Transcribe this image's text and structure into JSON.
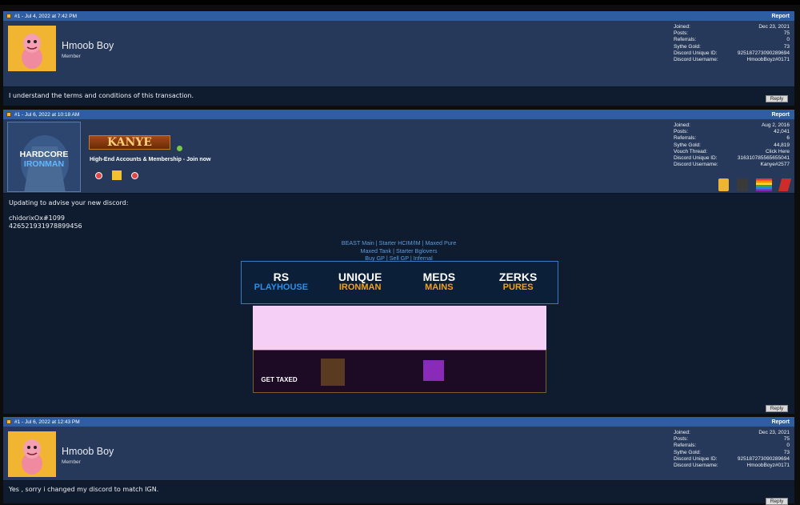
{
  "posts": [
    {
      "header": "#1 - Jul 4, 2022 at 7:42 PM",
      "report": "Report",
      "username": "Hmoob Boy",
      "role": "Member",
      "stats": [
        {
          "k": "Joined:",
          "v": "Dec 23, 2021"
        },
        {
          "k": "Posts:",
          "v": "75"
        },
        {
          "k": "Referrals:",
          "v": "0"
        },
        {
          "k": "Sythe Gold:",
          "v": "73"
        },
        {
          "k": "Discord Unique ID:",
          "v": "925187273090289694"
        },
        {
          "k": "Discord Username:",
          "v": "HmoobBoyz#0171"
        }
      ],
      "message": "I understand the terms and conditions of this transaction.",
      "reply": "Reply"
    },
    {
      "header": "#1 - Jul 6, 2022 at 10:18 AM",
      "report": "Report",
      "username": "KANYE",
      "avatar_line1": "HARDCORE",
      "avatar_line2": "IRONMAN",
      "tagline": "High-End Accounts & Membership - Join now",
      "stats": [
        {
          "k": "Joined:",
          "v": "Aug 2, 2016"
        },
        {
          "k": "Posts:",
          "v": "42,041"
        },
        {
          "k": "Referrals:",
          "v": "6"
        },
        {
          "k": "Sythe Gold:",
          "v": "44,819"
        },
        {
          "k": "Vouch Thread:",
          "v": "Click Here"
        },
        {
          "k": "Discord Unique ID:",
          "v": "316310785565655041"
        },
        {
          "k": "Discord Username:",
          "v": "Kanye#2577"
        }
      ],
      "message_lines": [
        "Updating to advise your new discord:",
        "",
        "chidorixOx#1099",
        "426521931978899456"
      ],
      "sig_line1": "BEAST Main | Starter HCIM/IM | Maxed Pure",
      "sig_line2": "Maxed Tank | Starter Bglovers",
      "sig_line3": "Buy GP | Sell GP | Infernal",
      "banner": [
        {
          "top": "RS",
          "bot": "PLAYHOUSE",
          "color": "#2e8de8"
        },
        {
          "top": "UNIQUE",
          "bot": "IRONMAN",
          "color": "#f2a21a"
        },
        {
          "top": "MEDS",
          "bot": "MAINS",
          "color": "#f2a21a"
        },
        {
          "top": "ZERKS",
          "bot": "PURES",
          "color": "#f2a21a"
        }
      ],
      "get_taxed": "GET TAXED",
      "reply": "Reply"
    },
    {
      "header": "#1 - Jul 6, 2022 at 12:43 PM",
      "report": "Report",
      "username": "Hmoob Boy",
      "role": "Member",
      "stats": [
        {
          "k": "Joined:",
          "v": "Dec 23, 2021"
        },
        {
          "k": "Posts:",
          "v": "75"
        },
        {
          "k": "Referrals:",
          "v": "0"
        },
        {
          "k": "Sythe Gold:",
          "v": "73"
        },
        {
          "k": "Discord Unique ID:",
          "v": "925187273090289694"
        },
        {
          "k": "Discord Username:",
          "v": "HmoobBoyz#0171"
        }
      ],
      "message": "Yes , sorry i changed my discord to match IGN.",
      "reply": "Reply"
    }
  ]
}
